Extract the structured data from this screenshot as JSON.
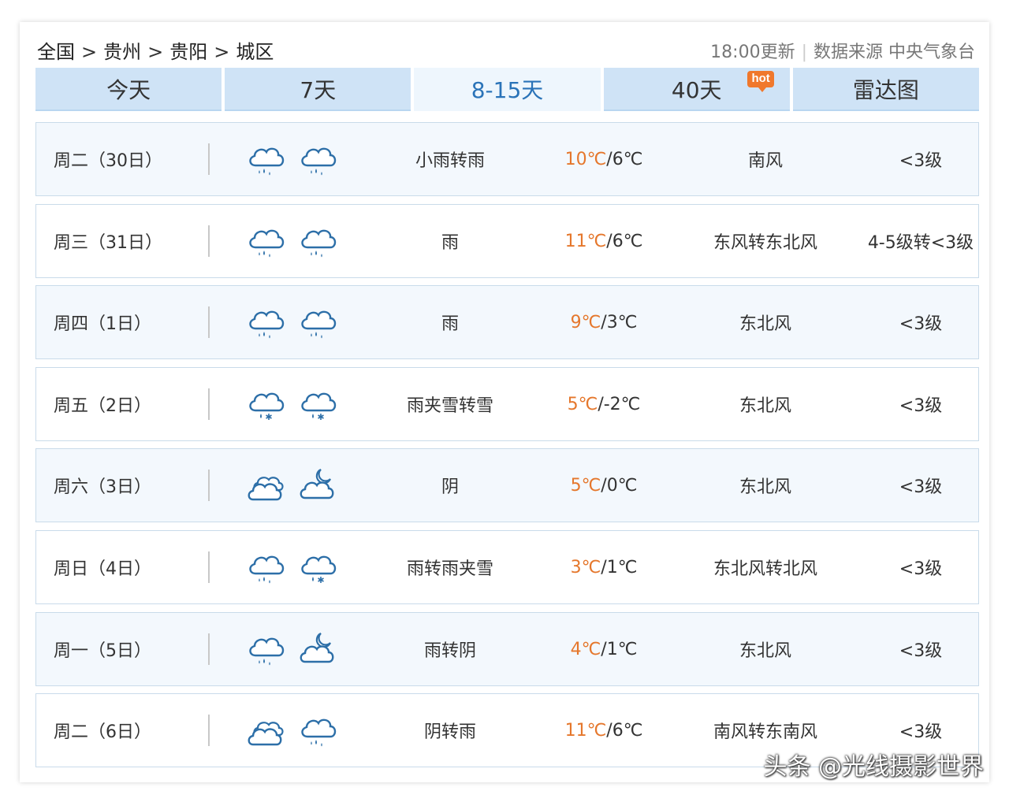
{
  "breadcrumb": {
    "items": [
      "全国",
      "贵州",
      "贵阳",
      "城区"
    ],
    "separator": ">"
  },
  "update": {
    "time": "18:00更新",
    "source": "数据来源 中央气象台"
  },
  "tabs": [
    {
      "label": "今天"
    },
    {
      "label": "7天"
    },
    {
      "label": "8-15天",
      "active": true
    },
    {
      "label": "40天",
      "badge": "hot"
    },
    {
      "label": "雷达图"
    }
  ],
  "forecast": [
    {
      "date": "周二（30日）",
      "icons": [
        "cloud-rain-icon",
        "cloud-rain-icon"
      ],
      "desc": "小雨转雨",
      "high": "10℃",
      "low": "/6℃",
      "wind": "南风",
      "level": "<3级"
    },
    {
      "date": "周三（31日）",
      "icons": [
        "cloud-rain-icon",
        "cloud-rain-icon"
      ],
      "desc": "雨",
      "high": "11℃",
      "low": "/6℃",
      "wind": "东风转东北风",
      "level": "4-5级转<3级"
    },
    {
      "date": "周四（1日）",
      "icons": [
        "cloud-rain-icon",
        "cloud-rain-icon"
      ],
      "desc": "雨",
      "high": "9℃",
      "low": "/3℃",
      "wind": "东北风",
      "level": "<3级"
    },
    {
      "date": "周五（2日）",
      "icons": [
        "cloud-sleet-icon",
        "cloud-sleet-icon"
      ],
      "desc": "雨夹雪转雪",
      "high": "5℃",
      "low": "/-2℃",
      "wind": "东北风",
      "level": "<3级"
    },
    {
      "date": "周六（3日）",
      "icons": [
        "overcast-icon",
        "cloudy-night-icon"
      ],
      "desc": "阴",
      "high": "5℃",
      "low": "/0℃",
      "wind": "东北风",
      "level": "<3级"
    },
    {
      "date": "周日（4日）",
      "icons": [
        "cloud-rain-icon",
        "cloud-sleet-icon"
      ],
      "desc": "雨转雨夹雪",
      "high": "3℃",
      "low": "/1℃",
      "wind": "东北风转北风",
      "level": "<3级"
    },
    {
      "date": "周一（5日）",
      "icons": [
        "cloud-rain-icon",
        "cloudy-night-icon"
      ],
      "desc": "雨转阴",
      "high": "4℃",
      "low": "/1℃",
      "wind": "东北风",
      "level": "<3级"
    },
    {
      "date": "周二（6日）",
      "icons": [
        "overcast-icon",
        "cloud-rain-icon"
      ],
      "desc": "阴转雨",
      "high": "11℃",
      "low": "/6℃",
      "wind": "南风转东南风",
      "level": "<3级"
    }
  ],
  "watermark": "头条 @光线摄影世界",
  "colors": {
    "tab_bg": "#cfe3f6",
    "tab_active_text": "#2a73b8",
    "high_temp": "#e5772c",
    "icon": "#2d6fa8",
    "hot_badge": "#f0782c"
  }
}
